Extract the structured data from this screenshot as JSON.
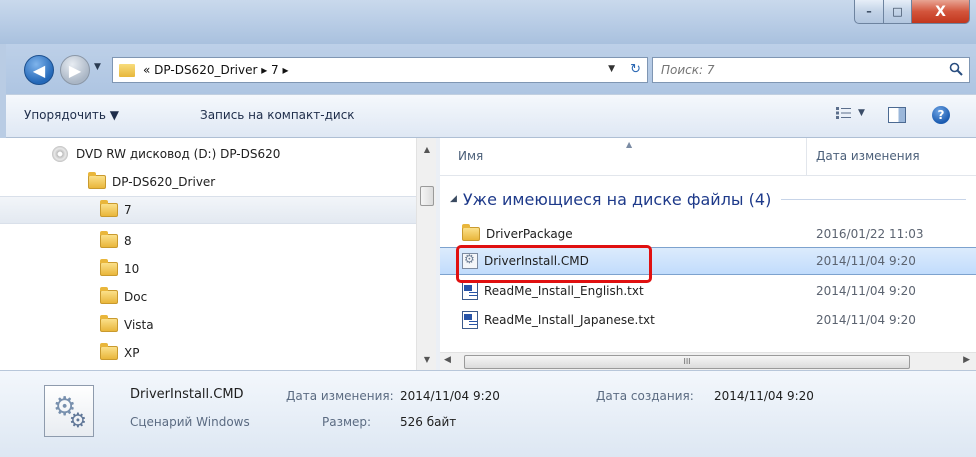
{
  "window": {
    "caption_min": "–",
    "caption_max": "□",
    "caption_close": "X"
  },
  "nav": {
    "back": "◀",
    "forward": "▶",
    "recent": "▼",
    "address_text": "«  DP-DS620_Driver  ▸  7  ▸",
    "address_drop": "▼",
    "refresh": "↻",
    "search_placeholder": "Поиск: 7"
  },
  "toolbar": {
    "organize": "Упорядочить ▼",
    "burn": "Запись на компакт-диск",
    "views_arrow": "▼",
    "help": "?"
  },
  "tree": [
    {
      "label": "DVD RW дисковод (D:) DP-DS620",
      "type": "dvd"
    },
    {
      "label": "DP-DS620_Driver",
      "type": "folder"
    },
    {
      "label": "7",
      "type": "folder",
      "selected": true
    },
    {
      "label": "8",
      "type": "folder"
    },
    {
      "label": "10",
      "type": "folder"
    },
    {
      "label": "Doc",
      "type": "folder"
    },
    {
      "label": "Vista",
      "type": "folder"
    },
    {
      "label": "XP",
      "type": "folder"
    }
  ],
  "columns": {
    "name": "Имя",
    "date": "Дата изменения"
  },
  "group": {
    "label": "Уже имеющиеся на диске файлы (4)"
  },
  "files": [
    {
      "name": "DriverPackage",
      "date": "2016/01/22 11:03",
      "type": "folder"
    },
    {
      "name": "DriverInstall.CMD",
      "date": "2014/11/04 9:20",
      "type": "cmd",
      "selected": true
    },
    {
      "name": "ReadMe_Install_English.txt",
      "date": "2014/11/04 9:20",
      "type": "txt"
    },
    {
      "name": "ReadMe_Install_Japanese.txt",
      "date": "2014/11/04 9:20",
      "type": "txt"
    }
  ],
  "hscroll": {
    "grip": "III"
  },
  "details": {
    "filename": "DriverInstall.CMD",
    "type": "Сценарий Windows",
    "modified_label": "Дата изменения:",
    "modified_value": "2014/11/04 9:20",
    "created_label": "Дата создания:",
    "created_value": "2014/11/04 9:20",
    "size_label": "Размер:",
    "size_value": "526 байт"
  },
  "colors": {
    "highlight": "#e01010",
    "group_text": "#1e3a8a"
  }
}
